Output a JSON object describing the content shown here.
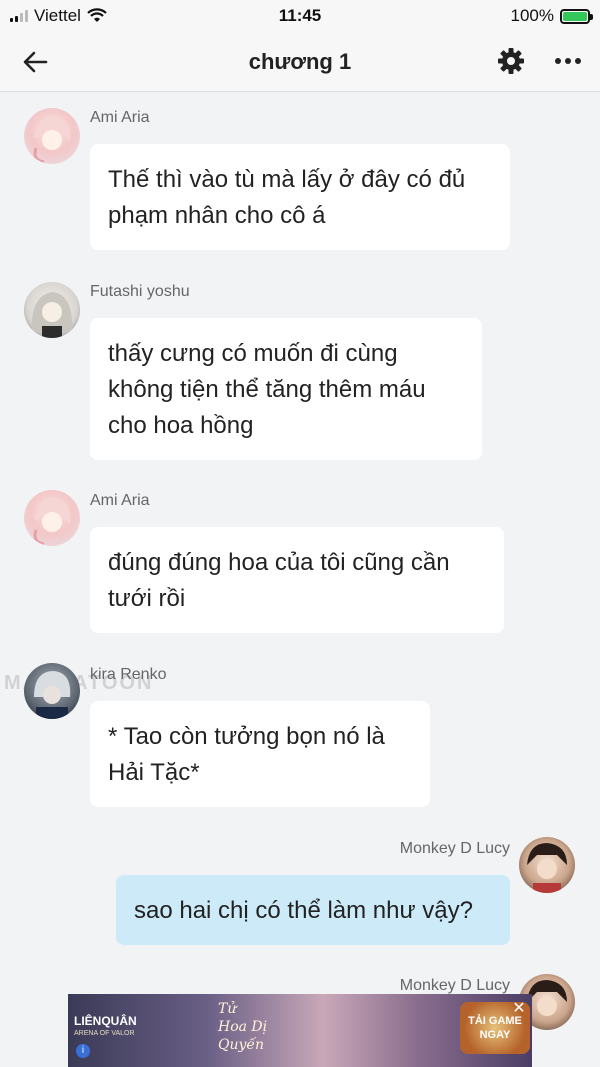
{
  "status_bar": {
    "carrier": "Viettel",
    "time": "11:45",
    "battery": "100%"
  },
  "header": {
    "title": "chương 1"
  },
  "messages": [
    {
      "sender": "Ami Aria",
      "text_lines": [
        "Thế thì vào tù mà lấy ở đây có đủ",
        "phạm nhân cho cô á"
      ],
      "mine": false
    },
    {
      "sender": "Futashi yoshu",
      "text_lines": [
        "thấy cưng có muốn đi cùng",
        "không tiện thể tăng thêm máu",
        "cho hoa hồng"
      ],
      "mine": false
    },
    {
      "sender": "Ami Aria",
      "text_lines": [
        "đúng đúng hoa của tôi cũng cần",
        "tưới rồi"
      ],
      "mine": false
    },
    {
      "sender": "kira Renko",
      "text_lines": [
        "* Tao còn tưởng bọn nó là",
        "Hải Tặc*"
      ],
      "mine": false
    },
    {
      "sender": "Monkey D Lucy",
      "text_lines": [
        "sao hai chị có thể làm như vậy?"
      ],
      "mine": true
    },
    {
      "sender": "Monkey D Lucy",
      "text_lines": [],
      "mine": true
    }
  ],
  "watermark": "MANGATOON",
  "ad": {
    "brand": "LIÊNQUÂN",
    "brand_sub": "ARENA OF VALOR",
    "script": "Tử Hoa Dị Quyến",
    "cta": "TẢI GAME NGAY",
    "close": "✕"
  },
  "colors": {
    "background": "#f2f3f5",
    "bubble_other": "#ffffff",
    "bubble_mine": "#cdeaf8",
    "battery_fill": "#34c759"
  },
  "icons": [
    "signal-icon",
    "wifi-icon",
    "battery-icon",
    "back-arrow-icon",
    "gear-icon",
    "more-icon",
    "close-icon",
    "info-icon"
  ]
}
